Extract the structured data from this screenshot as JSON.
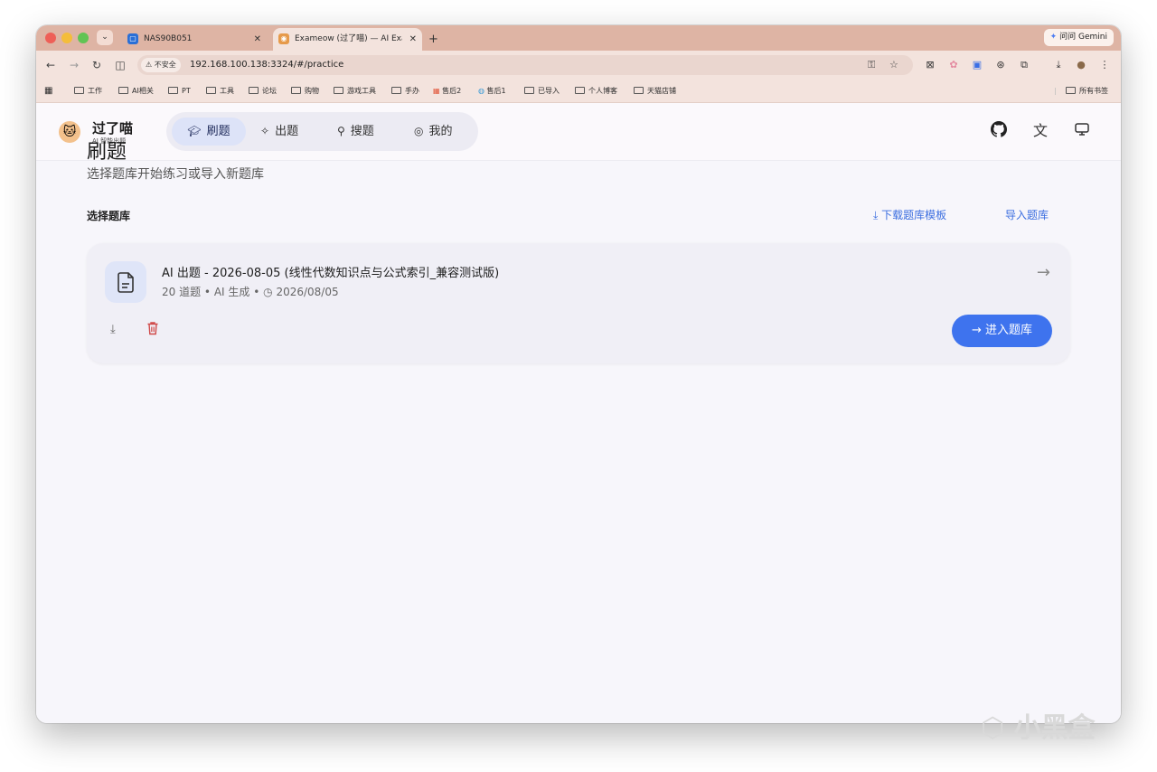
{
  "browser": {
    "tabs": [
      {
        "title": "NAS90B051",
        "close": "✕"
      },
      {
        "title": "Exameow (过了喵) — AI Exam",
        "close": "✕"
      }
    ],
    "new_tab": "+",
    "gemini": "问问 Gemini",
    "insecure": "不安全",
    "url": "192.168.100.138:3324/#/practice",
    "bookmarks": [
      "工作",
      "AI相关",
      "PT",
      "工具",
      "论坛",
      "购物",
      "游戏工具",
      "手办",
      "售后2",
      "售后1",
      "已导入",
      "个人博客",
      "天猫店铺"
    ],
    "all_bookmarks": "所有书签"
  },
  "app": {
    "name": "过了喵",
    "subtitle": "AI 智能出题",
    "nav": [
      {
        "label": "刷题",
        "icon": "graduation-cap-icon",
        "active": true
      },
      {
        "label": "出题",
        "icon": "sparkles-icon",
        "active": false
      },
      {
        "label": "搜题",
        "icon": "search-icon",
        "active": false
      },
      {
        "label": "我的",
        "icon": "user-circle-icon",
        "active": false
      }
    ]
  },
  "page": {
    "title": "刷题",
    "subtitle": "选择题库开始练习或导入新题库",
    "section_title": "选择题库",
    "download_template": "下载题库模板",
    "import_bank": "导入题库"
  },
  "bank": {
    "title": "AI 出题 - 2026-08-05 (线性代数知识点与公式索引_兼容测试版)",
    "count": "20 道题",
    "source": "AI 生成",
    "date": "2026/08/05",
    "enter": "进入题库"
  },
  "colors": {
    "accent": "#3e73ee",
    "tabbar": "#deb4a4",
    "danger": "#d04a4a"
  },
  "watermark": "小黑盒"
}
